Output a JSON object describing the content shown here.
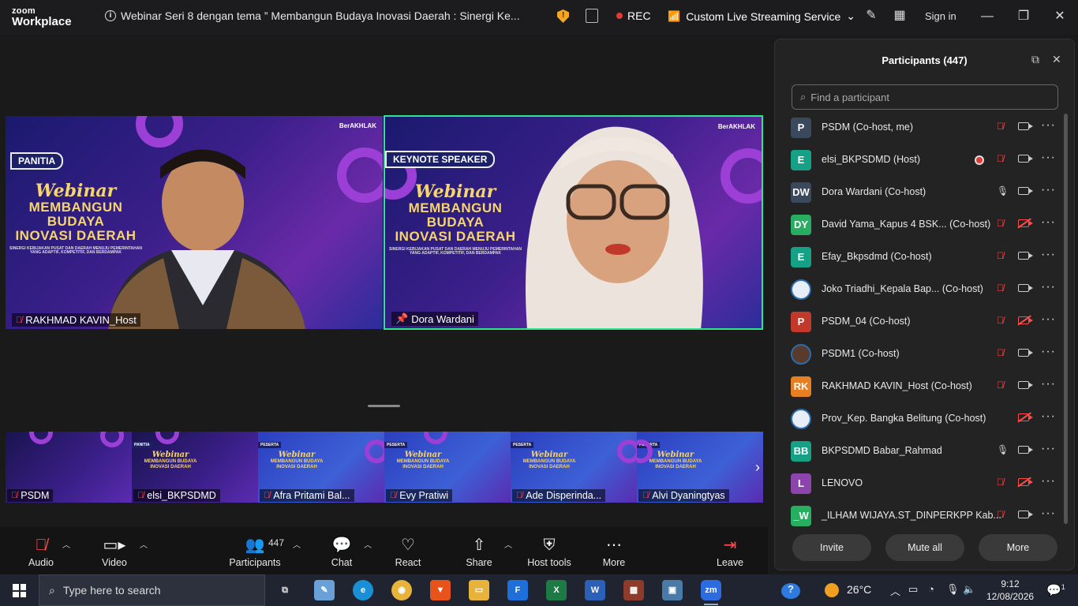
{
  "titlebar": {
    "logo_line1": "zoom",
    "logo_line2": "Workplace",
    "meeting_title": "Webinar Seri 8 dengan tema ” Membangun Budaya Inovasi Daerah : Sinergi Ke...",
    "rec_label": "REC",
    "stream_label": "Custom Live Streaming Service",
    "signin_label": "Sign in"
  },
  "videos": [
    {
      "tag": "PANITIA",
      "name": "RAKHMAD KAVIN_Host",
      "brand": "BerAKHLAK",
      "webinar": "Webinar",
      "headline1": "MEMBANGUN BUDAYA",
      "headline2": "INOVASI DAERAH",
      "sub": "SINERGI KEBIJAKAN PUSAT DAN DAERAH MENUJU PEMERINTAHAN YANG ADAPTIF, KOMPETITIF, DAN BERDAMPAK"
    },
    {
      "tag": "KEYNOTE SPEAKER",
      "name": "Dora Wardani",
      "brand": "BerAKHLAK",
      "webinar": "Webinar",
      "headline1": "MEMBANGUN BUDAYA",
      "headline2": "INOVASI DAERAH",
      "sub": "SINERGI KEBIJAKAN PUSAT DAN DAERAH MENUJU PEMERINTAHAN YANG ADAPTIF, KOMPETITIF, DAN BERDAMPAK"
    }
  ],
  "thumbnails": [
    {
      "name": "PSDM",
      "tag": ""
    },
    {
      "name": "elsi_BKPSDMD",
      "tag": "PANITIA"
    },
    {
      "name": "Afra Pritami Bal...",
      "tag": "PESERTA"
    },
    {
      "name": "Evy Pratiwi",
      "tag": "PESERTA"
    },
    {
      "name": "Ade Disperinda...",
      "tag": "PESERTA"
    },
    {
      "name": "Alvi Dyaningtyas",
      "tag": "PESERTA"
    }
  ],
  "toolbar": {
    "audio": "Audio",
    "video": "Video",
    "participants": "Participants",
    "participants_count": "447",
    "chat": "Chat",
    "react": "React",
    "share": "Share",
    "host_tools": "Host tools",
    "more": "More",
    "leave": "Leave"
  },
  "panel": {
    "title": "Participants (447)",
    "search_placeholder": "Find a participant",
    "invite": "Invite",
    "mute_all": "Mute all",
    "more": "More",
    "participants": [
      {
        "initials": "P",
        "color": "#3a4a5c",
        "name": "PSDM (Co-host, me)",
        "mic": "off",
        "cam": "on"
      },
      {
        "initials": "E",
        "color": "#16a085",
        "name": "elsi_BKPSDMD (Host)",
        "mic": "off",
        "cam": "on",
        "rec": true
      },
      {
        "initials": "DW",
        "color": "#3a4a5c",
        "name": "Dora Wardani (Co-host)",
        "mic": "on",
        "cam": "on"
      },
      {
        "initials": "DY",
        "color": "#27ae60",
        "name": "David Yama_Kapus 4 BSK... (Co-host)",
        "mic": "off",
        "cam": "off"
      },
      {
        "initials": "E",
        "color": "#16a085",
        "name": "Efay_Bkpsdmd (Co-host)",
        "mic": "off",
        "cam": "on"
      },
      {
        "initials": "",
        "color": "#e8eef5",
        "name": "Joko Triadhi_Kepala Bap...  (Co-host)",
        "mic": "off",
        "cam": "on"
      },
      {
        "initials": "P",
        "color": "#c0392b",
        "name": "PSDM_04 (Co-host)",
        "mic": "off",
        "cam": "off"
      },
      {
        "initials": "",
        "color": "#5a3a2a",
        "name": "PSDM1 (Co-host)",
        "mic": "off",
        "cam": "on"
      },
      {
        "initials": "RK",
        "color": "#e67e22",
        "name": "RAKHMAD KAVIN_Host (Co-host)",
        "mic": "off",
        "cam": "on"
      },
      {
        "initials": "",
        "color": "#e8eef5",
        "name": "Prov_Kep. Bangka Belitung (Co-host)",
        "mic": "none",
        "cam": "off"
      },
      {
        "initials": "BB",
        "color": "#16a085",
        "name": "BKPSDMD Babar_Rahmad",
        "mic": "on",
        "cam": "on"
      },
      {
        "initials": "L",
        "color": "#8e44ad",
        "name": "LENOVO",
        "mic": "off",
        "cam": "off"
      },
      {
        "initials": "_W",
        "color": "#27ae60",
        "name": "_ILHAM WIJAYA.ST_DINPERKPP Kab...",
        "mic": "off",
        "cam": "on"
      }
    ]
  },
  "taskbar": {
    "search_placeholder": "Type here to search",
    "temperature": "26°C",
    "time": "9:12",
    "date": "12/08/2026",
    "notification_count": "1"
  },
  "colors": {
    "active_speaker_border": "#2ee58a",
    "rec_red": "#e53935",
    "mic_muted": "#ff4c4c"
  }
}
